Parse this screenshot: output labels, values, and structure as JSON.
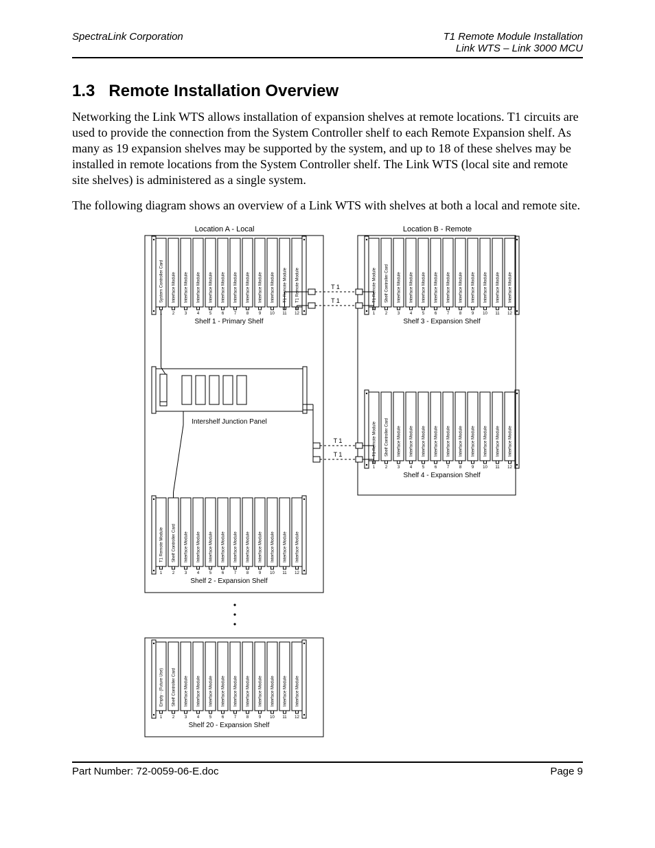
{
  "header": {
    "left": "SpectraLink Corporation",
    "right1": "T1 Remote Module Installation",
    "right2": "Link WTS – Link 3000 MCU"
  },
  "section": {
    "number": "1.3",
    "title": "Remote Installation Overview"
  },
  "paragraphs": {
    "p1": " Networking the Link WTS allows installation of expansion shelves at remote locations. T1 circuits are used to provide the connection from the System Controller shelf to each Remote Expansion shelf.  As many as 19 expansion shelves may be supported by the system, and up to 18 of these shelves may be installed in remote locations from the System Controller shelf.  The Link WTS (local site and remote site shelves) is administered as a single system.",
    "p2": "The following diagram shows an overview of a Link WTS with shelves at both a local and remote site."
  },
  "diagram": {
    "locA": "Location A - Local",
    "locB": "Location B - Remote",
    "shelf1": {
      "title": "Shelf 1 - Primary Shelf",
      "slots": [
        "System Controller Card",
        "Interface Module",
        "Interface Module",
        "Interface Module",
        "Interface Module",
        "Interface Module",
        "Interface Module",
        "Interface Module",
        "Interface Module",
        "Interface Module",
        "T1 Remote Module",
        "T1 Remote Module"
      ],
      "nums": [
        "1",
        "2",
        "3",
        "4",
        "5",
        "6",
        "7",
        "8",
        "9",
        "10",
        "11",
        "12"
      ]
    },
    "shelf2": {
      "title": "Shelf 2 - Expansion Shelf",
      "slots": [
        "T1 Remote Module",
        "Shelf Controller Card",
        "Interface Module",
        "Interface Module",
        "Interface Module",
        "Interface Module",
        "Interface Module",
        "Interface Module",
        "Interface Module",
        "Interface Module",
        "Interface Module",
        "Interface Module"
      ],
      "nums": [
        "1",
        "2",
        "3",
        "4",
        "5",
        "6",
        "7",
        "8",
        "9",
        "10",
        "11",
        "12"
      ]
    },
    "shelf3": {
      "title": "Shelf 3 - Expansion Shelf",
      "slots": [
        "T1 Remote Module",
        "Shelf Controller Card",
        "Interface Module",
        "Interface Module",
        "Interface Module",
        "Interface Module",
        "Interface Module",
        "Interface Module",
        "Interface Module",
        "Interface Module",
        "Interface Module",
        "Interface Module"
      ],
      "nums": [
        "1",
        "2",
        "3",
        "4",
        "5",
        "6",
        "7",
        "8",
        "9",
        "10",
        "11",
        "12"
      ]
    },
    "shelf4": {
      "title": "Shelf 4 - Expansion Shelf",
      "slots": [
        "T1 Remote Module",
        "Shelf Controller Card",
        "Interface Module",
        "Interface Module",
        "Interface Module",
        "Interface Module",
        "Interface Module",
        "Interface Module",
        "Interface Module",
        "Interface Module",
        "Interface Module",
        "Interface Module"
      ],
      "nums": [
        "1",
        "2",
        "3",
        "4",
        "5",
        "6",
        "7",
        "8",
        "9",
        "10",
        "11",
        "12"
      ]
    },
    "shelf20": {
      "title": "Shelf 20 - Expansion Shelf",
      "slots": [
        "Empty - (Future Use)",
        "Shelf Controller Card",
        "Interface Module",
        "Interface Module",
        "Interface Module",
        "Interface Module",
        "Interface Module",
        "Interface Module",
        "Interface Module",
        "Interface Module",
        "Interface Module",
        "Interface Module"
      ],
      "nums": [
        "1",
        "2",
        "3",
        "4",
        "5",
        "6",
        "7",
        "8",
        "9",
        "10",
        "11",
        "12"
      ]
    },
    "ijp": "Intershelf Junction Panel",
    "t1": "T 1"
  },
  "footer": {
    "left": "Part Number: 72-0059-06-E.doc",
    "right": "Page 9"
  }
}
